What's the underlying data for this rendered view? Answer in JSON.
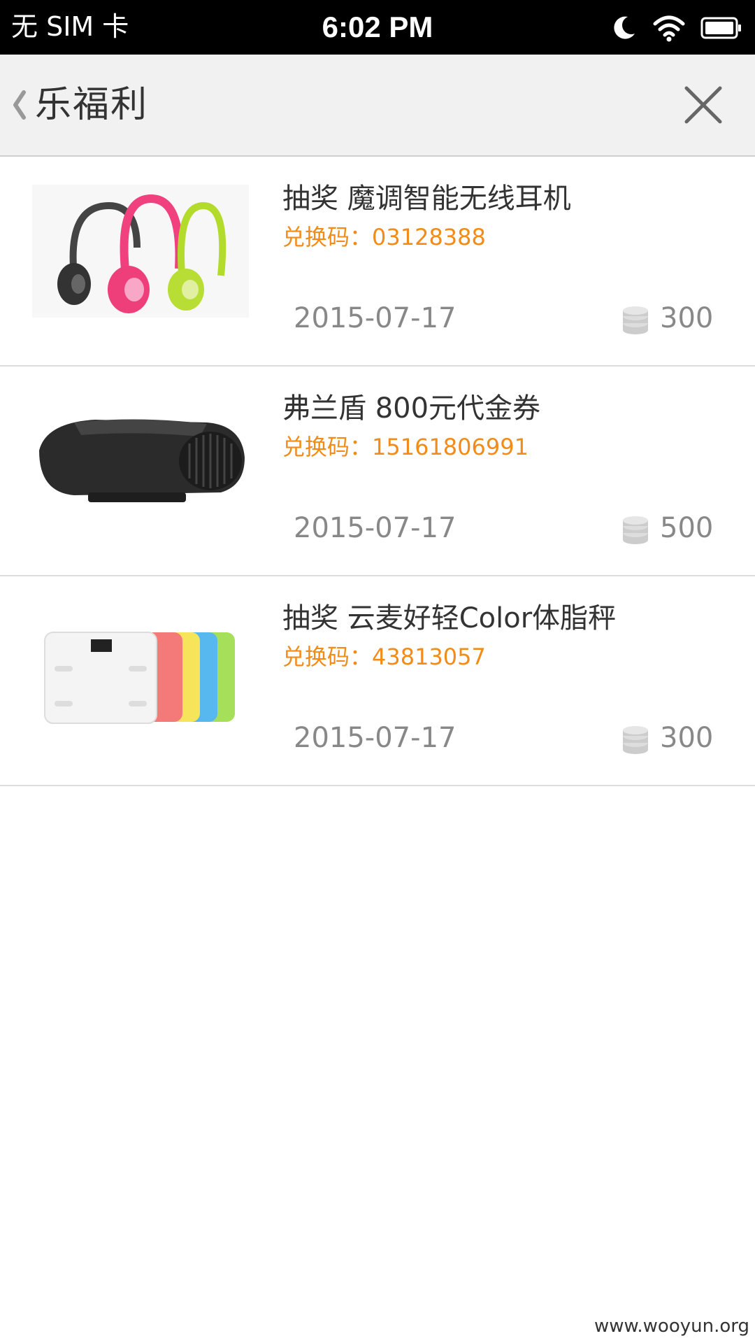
{
  "status_bar": {
    "carrier": "无 SIM 卡",
    "time": "6:02 PM",
    "icons": [
      "moon-icon",
      "wifi-icon",
      "battery-icon"
    ]
  },
  "header": {
    "back_icon": "chevron-left-icon",
    "title": "乐福利",
    "close_icon": "close-icon"
  },
  "items": [
    {
      "title": "抽奖 魔调智能无线耳机",
      "code": "兑换码：03128388",
      "date": "2015-07-17",
      "points": "300",
      "image": "headphones-image"
    },
    {
      "title": "弗兰盾 800元代金券",
      "code": "兑换码：15161806991",
      "date": "2015-07-17",
      "points": "500",
      "image": "air-purifier-image"
    },
    {
      "title": "抽奖 云麦好轻Color体脂秤",
      "code": "兑换码：43813057",
      "date": "2015-07-17",
      "points": "300",
      "image": "body-fat-scale-image"
    }
  ],
  "colors": {
    "accent": "#f28c18",
    "header_bg": "#f1f1f1",
    "status_bg": "#000000"
  },
  "watermark": "www.wooyun.org"
}
